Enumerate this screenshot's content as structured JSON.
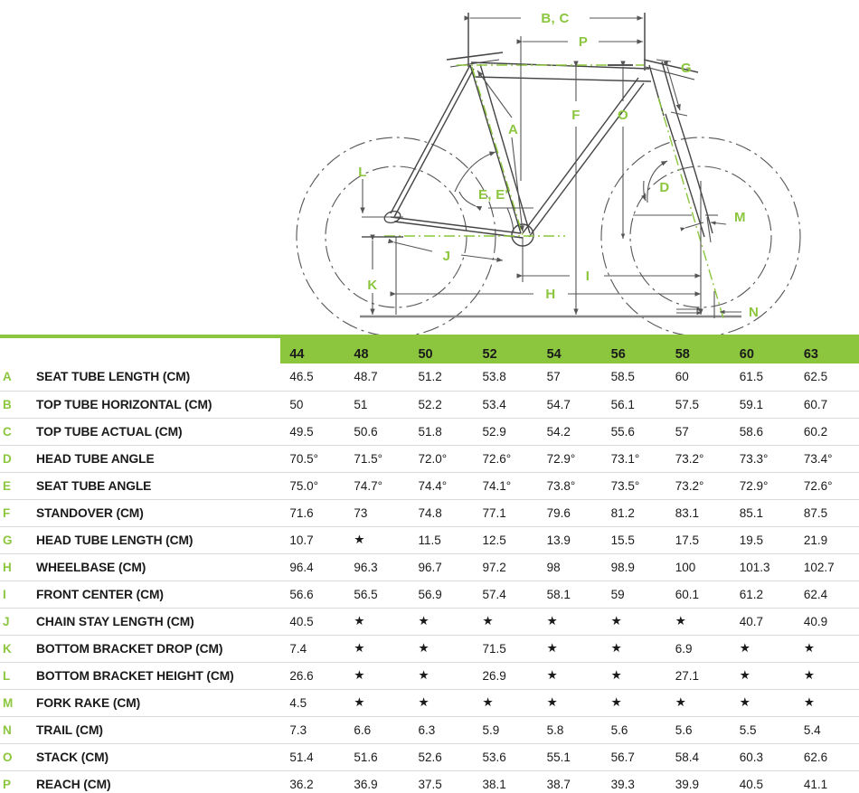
{
  "diagram": {
    "name": "bicycle-geometry-diagram",
    "accent_color": "#8CC63F",
    "line_color": "#555555",
    "labels": [
      {
        "id": "BC",
        "text": "B, C"
      },
      {
        "id": "P",
        "text": "P"
      },
      {
        "id": "G",
        "text": "G"
      },
      {
        "id": "A",
        "text": "A"
      },
      {
        "id": "F",
        "text": "F"
      },
      {
        "id": "O",
        "text": "O"
      },
      {
        "id": "L",
        "text": "L"
      },
      {
        "id": "EE",
        "text": "E, E'"
      },
      {
        "id": "D",
        "text": "D"
      },
      {
        "id": "M",
        "text": "M"
      },
      {
        "id": "K",
        "text": "K"
      },
      {
        "id": "J",
        "text": "J"
      },
      {
        "id": "I",
        "text": "I"
      },
      {
        "id": "H",
        "text": "H"
      },
      {
        "id": "N",
        "text": "N"
      }
    ]
  },
  "table": {
    "corner_label": "",
    "sizes": [
      "44",
      "48",
      "50",
      "52",
      "54",
      "56",
      "58",
      "60",
      "63"
    ],
    "rows": [
      {
        "letter": "A",
        "name": "SEAT TUBE LENGTH (CM)",
        "values": [
          "46.5",
          "48.7",
          "51.2",
          "53.8",
          "57",
          "58.5",
          "60",
          "61.5",
          "62.5"
        ]
      },
      {
        "letter": "B",
        "name": "TOP TUBE HORIZONTAL (CM)",
        "values": [
          "50",
          "51",
          "52.2",
          "53.4",
          "54.7",
          "56.1",
          "57.5",
          "59.1",
          "60.7"
        ]
      },
      {
        "letter": "C",
        "name": "TOP TUBE ACTUAL (CM)",
        "values": [
          "49.5",
          "50.6",
          "51.8",
          "52.9",
          "54.2",
          "55.6",
          "57",
          "58.6",
          "60.2"
        ]
      },
      {
        "letter": "D",
        "name": "HEAD TUBE ANGLE",
        "values": [
          "70.5°",
          "71.5°",
          "72.0°",
          "72.6°",
          "72.9°",
          "73.1°",
          "73.2°",
          "73.3°",
          "73.4°"
        ]
      },
      {
        "letter": "E",
        "name": "SEAT TUBE ANGLE",
        "values": [
          "75.0°",
          "74.7°",
          "74.4°",
          "74.1°",
          "73.8°",
          "73.5°",
          "73.2°",
          "72.9°",
          "72.6°"
        ]
      },
      {
        "letter": "F",
        "name": "STANDOVER (CM)",
        "values": [
          "71.6",
          "73",
          "74.8",
          "77.1",
          "79.6",
          "81.2",
          "83.1",
          "85.1",
          "87.5"
        ]
      },
      {
        "letter": "G",
        "name": "HEAD TUBE LENGTH (CM)",
        "values": [
          "10.7",
          "★",
          "11.5",
          "12.5",
          "13.9",
          "15.5",
          "17.5",
          "19.5",
          "21.9"
        ]
      },
      {
        "letter": "H",
        "name": "WHEELBASE (CM)",
        "values": [
          "96.4",
          "96.3",
          "96.7",
          "97.2",
          "98",
          "98.9",
          "100",
          "101.3",
          "102.7"
        ]
      },
      {
        "letter": "I",
        "name": "FRONT CENTER (CM)",
        "values": [
          "56.6",
          "56.5",
          "56.9",
          "57.4",
          "58.1",
          "59",
          "60.1",
          "61.2",
          "62.4"
        ]
      },
      {
        "letter": "J",
        "name": "CHAIN STAY LENGTH (CM)",
        "values": [
          "40.5",
          "★",
          "★",
          "★",
          "★",
          "★",
          "★",
          "40.7",
          "40.9"
        ]
      },
      {
        "letter": "K",
        "name": "BOTTOM BRACKET DROP (CM)",
        "values": [
          "7.4",
          "★",
          "★",
          "71.5",
          "★",
          "★",
          "6.9",
          "★",
          "★"
        ]
      },
      {
        "letter": "L",
        "name": "BOTTOM BRACKET HEIGHT (CM)",
        "values": [
          "26.6",
          "★",
          "★",
          "26.9",
          "★",
          "★",
          "27.1",
          "★",
          "★"
        ]
      },
      {
        "letter": "M",
        "name": "FORK RAKE (CM)",
        "values": [
          "4.5",
          "★",
          "★",
          "★",
          "★",
          "★",
          "★",
          "★",
          "★"
        ]
      },
      {
        "letter": "N",
        "name": "TRAIL (CM)",
        "values": [
          "7.3",
          "6.6",
          "6.3",
          "5.9",
          "5.8",
          "5.6",
          "5.6",
          "5.5",
          "5.4"
        ]
      },
      {
        "letter": "O",
        "name": "STACK (CM)",
        "values": [
          "51.4",
          "51.6",
          "52.6",
          "53.6",
          "55.1",
          "56.7",
          "58.4",
          "60.3",
          "62.6"
        ]
      },
      {
        "letter": "P",
        "name": "REACH (CM)",
        "values": [
          "36.2",
          "36.9",
          "37.5",
          "38.1",
          "38.7",
          "39.3",
          "39.9",
          "40.5",
          "41.1"
        ]
      }
    ]
  }
}
